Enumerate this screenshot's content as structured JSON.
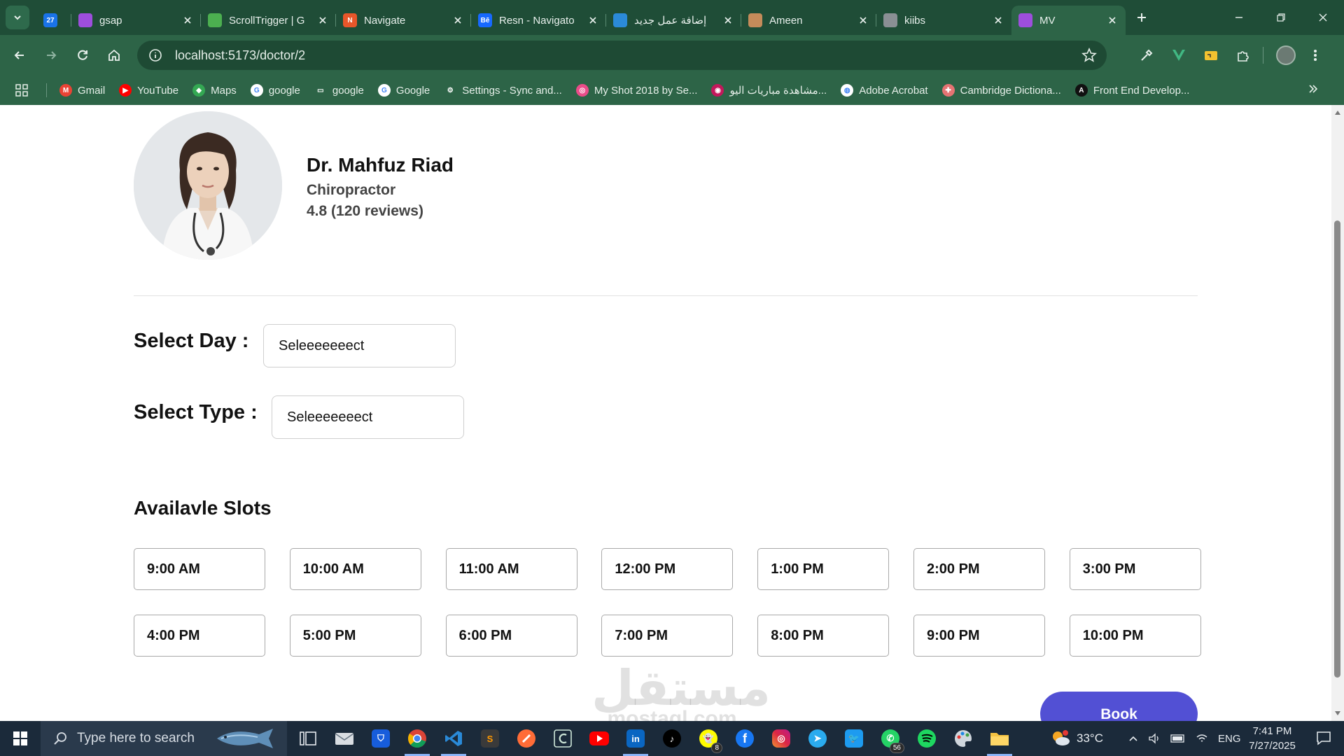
{
  "browser": {
    "tabs": [
      {
        "title": "",
        "favicon": "calendar-icon",
        "fav_text": "27",
        "color": "#1a73e8"
      },
      {
        "title": "gsap",
        "favicon": "vite-icon",
        "fav_text": "",
        "color": "#9d4edd"
      },
      {
        "title": "ScrollTrigger | G",
        "favicon": "gsap-clover-icon",
        "fav_text": "",
        "color": "#4caf50"
      },
      {
        "title": "Navigate",
        "favicon": "navigate-n-icon",
        "fav_text": "N",
        "color": "#e8562a"
      },
      {
        "title": "Resn - Navigato",
        "favicon": "behance-icon",
        "fav_text": "Bē",
        "color": "#1769ff"
      },
      {
        "title": "إضافة عمل جديد",
        "favicon": "mostaql-icon",
        "fav_text": "",
        "color": "#2b8ad8"
      },
      {
        "title": "Ameen",
        "favicon": "person-icon",
        "fav_text": "",
        "color": "#c58b5a"
      },
      {
        "title": "kiibs",
        "favicon": "globe-icon",
        "fav_text": "",
        "color": "#8a8f94"
      },
      {
        "title": "MV",
        "favicon": "vite-icon",
        "fav_text": "",
        "color": "#9d4edd",
        "active": true
      }
    ],
    "url": "localhost:5173/doctor/2",
    "bookmarks": [
      {
        "label": "Gmail",
        "icon": "gmail-icon",
        "color": "#ea4335",
        "glyph": "M"
      },
      {
        "label": "YouTube",
        "icon": "youtube-icon",
        "color": "#ff0000",
        "glyph": "▶"
      },
      {
        "label": "Maps",
        "icon": "maps-pin-icon",
        "color": "#34a853",
        "glyph": "◆"
      },
      {
        "label": "google",
        "icon": "google-icon",
        "color": "#ffffff",
        "glyph": "G"
      },
      {
        "label": "google",
        "icon": "folder-icon",
        "color": "transparent",
        "glyph": "▭"
      },
      {
        "label": "Google",
        "icon": "google-icon",
        "color": "#ffffff",
        "glyph": "G"
      },
      {
        "label": "Settings - Sync and...",
        "icon": "settings-gear-icon",
        "color": "transparent",
        "glyph": "⚙"
      },
      {
        "label": "My Shot 2018 by Se...",
        "icon": "dribbble-icon",
        "color": "#ea4c89",
        "glyph": "◎"
      },
      {
        "label": "مشاهدة مباريات اليو...",
        "icon": "sports-icon",
        "color": "#c2185b",
        "glyph": "◉"
      },
      {
        "label": "Adobe Acrobat",
        "icon": "globe-icon",
        "color": "#ffffff",
        "glyph": "◍"
      },
      {
        "label": "Cambridge Dictiona...",
        "icon": "cambridge-icon",
        "color": "#e57373",
        "glyph": "✚"
      },
      {
        "label": "Front End Develop...",
        "icon": "frontend-a-icon",
        "color": "#111111",
        "glyph": "A"
      }
    ]
  },
  "doctor": {
    "name": "Dr. Mahfuz Riad",
    "specialty": "Chiropractor",
    "rating": "4.8 (120 reviews)"
  },
  "form": {
    "day_label": "Select Day :",
    "day_value": "Seleeeeeeect",
    "type_label": "Select Type :",
    "type_value": "Seleeeeeeect"
  },
  "slots": {
    "title": "Availavle Slots",
    "times": [
      "9:00 AM",
      "10:00 AM",
      "11:00 AM",
      "12:00 PM",
      "1:00 PM",
      "2:00 PM",
      "3:00 PM",
      "4:00 PM",
      "5:00 PM",
      "6:00 PM",
      "7:00 PM",
      "8:00 PM",
      "9:00 PM",
      "10:00 PM"
    ]
  },
  "book_label": "Book",
  "watermark": {
    "ar": "مستقل",
    "en": "mostaql.com"
  },
  "taskbar": {
    "search_placeholder": "Type here to search",
    "temperature": "33°C",
    "language": "ENG",
    "time": "7:41 PM",
    "date": "7/27/2025",
    "snapchat_badge": "8",
    "whatsapp_badge": "56"
  },
  "colors": {
    "browser_frame": "#2d6447",
    "tabstrip": "#1f4d37",
    "book_button": "#5250d4"
  }
}
